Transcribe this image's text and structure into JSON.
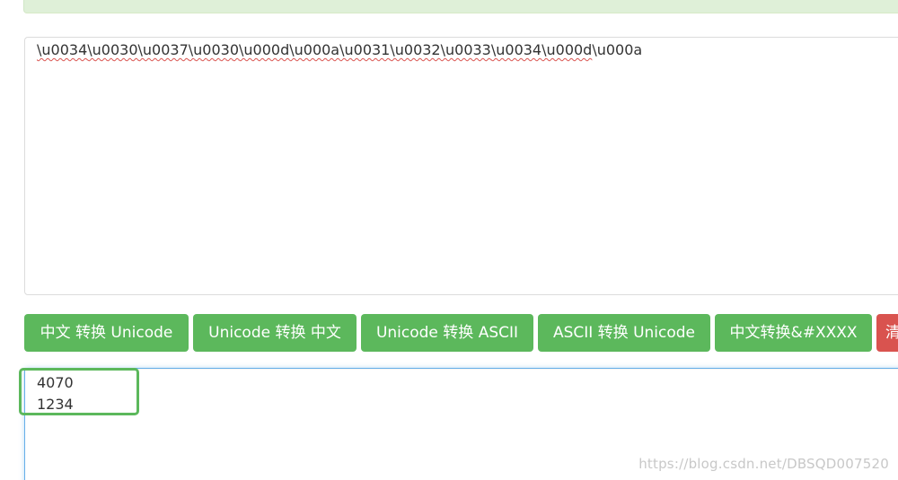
{
  "input": {
    "tokens": [
      "\\u0034",
      "\\u0030",
      "\\u0037",
      "\\u0030",
      "\\u000d",
      "\\u000a",
      "\\u0031",
      "\\u0032",
      "\\u0033",
      "\\u0034",
      "\\u000d",
      "\\u000a"
    ]
  },
  "buttons": [
    {
      "label": "中文 转换 Unicode"
    },
    {
      "label": "Unicode 转换 中文"
    },
    {
      "label": "Unicode 转换 ASCII"
    },
    {
      "label": "ASCII 转换 Unicode"
    },
    {
      "label": "中文转换&#XXXX"
    },
    {
      "label": "清"
    }
  ],
  "output": {
    "lines": [
      "4070",
      "1234"
    ]
  },
  "watermark": "https://blog.csdn.net/DBSQD007520",
  "colors": {
    "button_green": "#5cb85c",
    "button_red": "#d9534f",
    "banner": "#dff0d8",
    "highlight": "#5cb85c"
  }
}
